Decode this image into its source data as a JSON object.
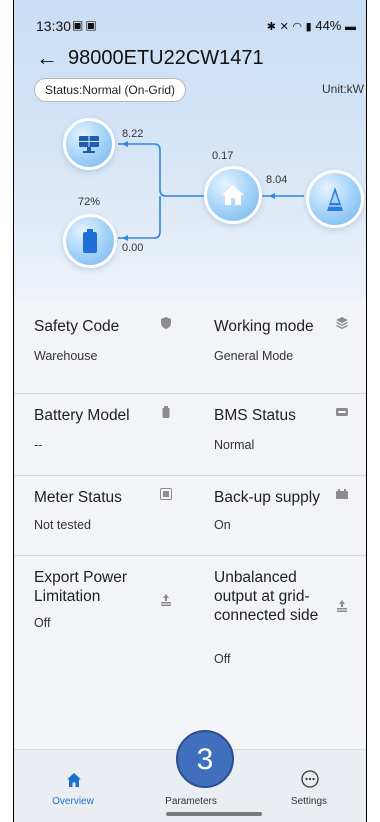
{
  "status_bar": {
    "time": "13:30",
    "left_icons": [
      "gallery-icon",
      "message-icon"
    ],
    "right_text": "44%",
    "right_icons": [
      "bluetooth-icon",
      "mute-icon",
      "wifi-icon",
      "signal-icon",
      "battery-icon"
    ]
  },
  "header": {
    "title": "98000ETU22CW1471",
    "status": "Status:Normal (On-Grid)",
    "unit": "Unit:kW"
  },
  "flow": {
    "pv_value": "8.22",
    "battery_soc": "72%",
    "battery_value": "0.00",
    "load_value": "0.17",
    "grid_value": "8.04",
    "colors": {
      "line": "#2f86e0",
      "node": "#8cc6f5"
    }
  },
  "info": [
    {
      "left": {
        "title": "Safety Code",
        "value": "Warehouse",
        "icon": "shield-icon"
      },
      "right": {
        "title": "Working mode",
        "value": "General Mode",
        "icon": "layers-icon"
      }
    },
    {
      "left": {
        "title": "Battery Model",
        "value": "--",
        "icon": "battery-icon"
      },
      "right": {
        "title": "BMS Status",
        "value": "Normal",
        "icon": "bms-icon"
      }
    },
    {
      "left": {
        "title": "Meter Status",
        "value": "Not tested",
        "icon": "meter-icon"
      },
      "right": {
        "title": "Back-up supply",
        "value": "On",
        "icon": "backup-icon"
      }
    },
    {
      "left": {
        "title": "Export Power Limitation",
        "value": "Off",
        "icon": "export-limit-icon"
      },
      "right": {
        "title": "Unbalanced output at grid-connected side",
        "value": "Off",
        "icon": "unbalanced-icon"
      }
    }
  ],
  "nav": {
    "items": [
      {
        "label": "Overview",
        "icon": "home-icon",
        "active": true
      },
      {
        "label": "Parameters",
        "icon": "parameters-icon",
        "active": false
      },
      {
        "label": "Settings",
        "icon": "more-icon",
        "active": false
      }
    ],
    "active_color": "#1b6fd1"
  },
  "annotation": {
    "number": "3",
    "color": "#3f6fbd"
  }
}
